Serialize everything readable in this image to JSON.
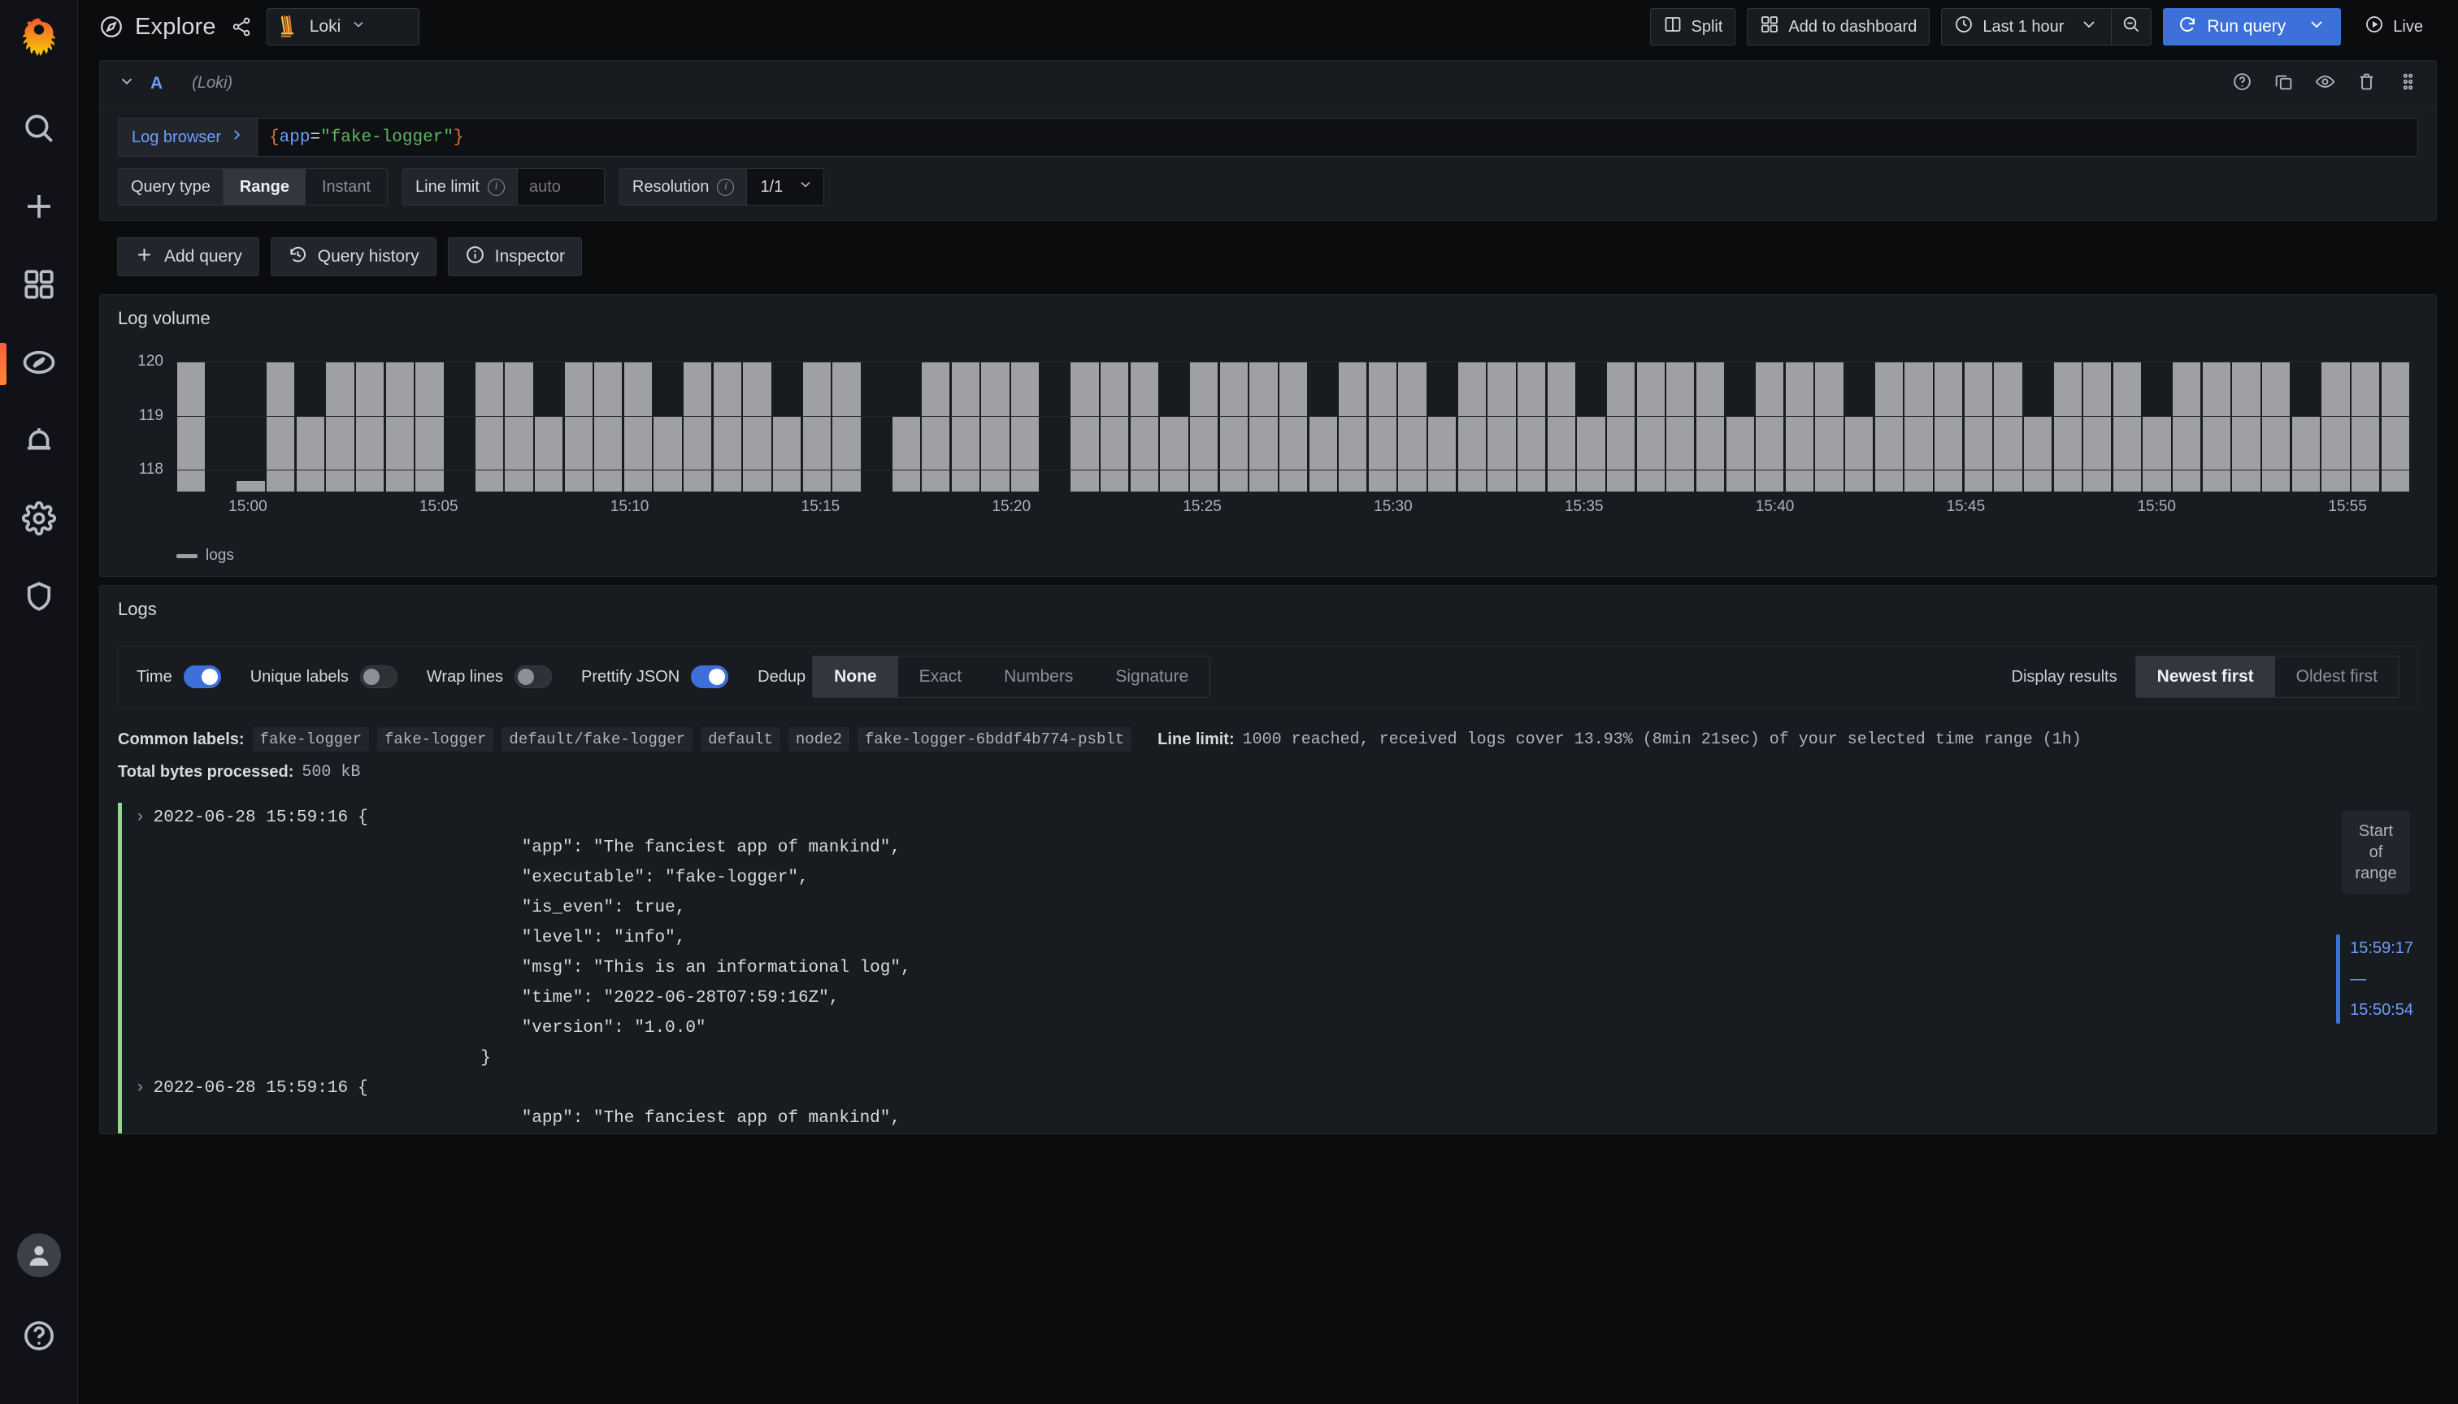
{
  "leftnav": {
    "items": [
      {
        "name": "search-icon",
        "label": "Search"
      },
      {
        "name": "plus-icon",
        "label": "Create"
      },
      {
        "name": "dashboards-icon",
        "label": "Dashboards"
      },
      {
        "name": "compass-icon",
        "label": "Explore"
      },
      {
        "name": "bell-icon",
        "label": "Alerting"
      },
      {
        "name": "gear-icon",
        "label": "Configuration"
      },
      {
        "name": "shield-icon",
        "label": "Server Admin"
      }
    ],
    "help_label": "Help",
    "avatar_label": "User"
  },
  "header": {
    "title": "Explore",
    "share_label": "Share",
    "datasource": "Loki",
    "buttons": {
      "split": "Split",
      "add_to_dashboard": "Add to dashboard",
      "time_range": "Last 1 hour",
      "zoom_out": "Zoom out",
      "run_query": "Run query",
      "live": "Live"
    }
  },
  "query": {
    "id": "A",
    "datasource_note": "(Loki)",
    "log_browser_label": "Log browser",
    "expr": {
      "open_brace": "{",
      "label": "app",
      "operator": "=",
      "value": "\"fake-logger\"",
      "close_brace": "}",
      "full": "{app=\"fake-logger\"}"
    },
    "query_type_label": "Query type",
    "query_type_options": [
      "Range",
      "Instant"
    ],
    "query_type_selected": "Range",
    "line_limit_label": "Line limit",
    "line_limit_placeholder": "auto",
    "line_limit_value": "",
    "resolution_label": "Resolution",
    "resolution_value": "1/1",
    "actions": {
      "add_query": "Add query",
      "query_history": "Query history",
      "inspector": "Inspector"
    }
  },
  "log_volume": {
    "title": "Log volume"
  },
  "chart_data": {
    "type": "bar",
    "title": "Log volume",
    "xlabel": "",
    "ylabel": "",
    "ylim": [
      117.6,
      120
    ],
    "yticks": [
      118,
      119,
      120
    ],
    "grid": true,
    "legend": [
      {
        "name": "logs",
        "color": "#9fa0a3"
      }
    ],
    "legend_position": "bottom-left",
    "x_tick_labels": [
      "15:00",
      "15:05",
      "15:10",
      "15:15",
      "15:20",
      "15:25",
      "15:30",
      "15:35",
      "15:40",
      "15:45",
      "15:50",
      "15:55"
    ],
    "series": [
      {
        "name": "logs",
        "color": "#9fa0a3",
        "values": [
          120,
          0,
          117.8,
          120,
          119,
          120,
          120,
          120,
          120,
          0,
          120,
          120,
          119,
          120,
          120,
          120,
          119,
          120,
          120,
          120,
          119,
          120,
          120,
          0,
          119,
          120,
          120,
          120,
          120,
          0,
          120,
          120,
          120,
          119,
          120,
          120,
          120,
          120,
          119,
          120,
          120,
          120,
          119,
          120,
          120,
          120,
          120,
          119,
          120,
          120,
          120,
          120,
          119,
          120,
          120,
          120,
          119,
          120,
          120,
          120,
          120,
          120,
          119,
          120,
          120,
          120,
          119,
          120,
          120,
          120,
          120,
          119,
          120,
          120,
          120
        ]
      }
    ]
  },
  "logs": {
    "title": "Logs",
    "options": {
      "time_label": "Time",
      "time_on": true,
      "unique_labels_label": "Unique labels",
      "unique_labels_on": false,
      "wrap_lines_label": "Wrap lines",
      "wrap_lines_on": false,
      "prettify_json_label": "Prettify JSON",
      "prettify_json_on": true,
      "dedup_label": "Dedup",
      "dedup_options": [
        "None",
        "Exact",
        "Numbers",
        "Signature"
      ],
      "dedup_selected": "None",
      "display_results_label": "Display results",
      "display_results_options": [
        "Newest first",
        "Oldest first"
      ],
      "display_results_selected": "Newest first"
    },
    "common_labels_label": "Common labels:",
    "common_labels": [
      "fake-logger",
      "fake-logger",
      "default/fake-logger",
      "default",
      "node2",
      "fake-logger-6bddf4b774-psblt"
    ],
    "line_limit_label": "Line limit:",
    "line_limit_text": "1000 reached, received logs cover 13.93% (8min 21sec) of your selected time range (1h)",
    "total_bytes_label": "Total bytes processed:",
    "total_bytes_value": "500  kB",
    "entries": [
      {
        "timestamp": "2022-06-28 15:59:16",
        "body": "{\n                \"app\": \"The fanciest app of mankind\",\n                \"executable\": \"fake-logger\",\n                \"is_even\": true,\n                \"level\": \"info\",\n                \"msg\": \"This is an informational log\",\n                \"time\": \"2022-06-28T07:59:16Z\",\n                \"version\": \"1.0.0\"\n            }"
      },
      {
        "timestamp": "2022-06-28 15:59:16",
        "body": "{\n                \"app\": \"The fanciest app of mankind\","
      }
    ],
    "range_box_label": "Start\nof\nrange",
    "range_start_time": "15:59:17",
    "range_dash": "—",
    "range_end_time": "15:50:54"
  },
  "colors": {
    "accent_blue": "#3d71d9",
    "link_blue": "#6e9fff",
    "bar_gray": "#9fa0a3",
    "level_green": "#8fd98f",
    "panel_bg": "#181b1f",
    "page_bg": "#0b0c0e"
  }
}
